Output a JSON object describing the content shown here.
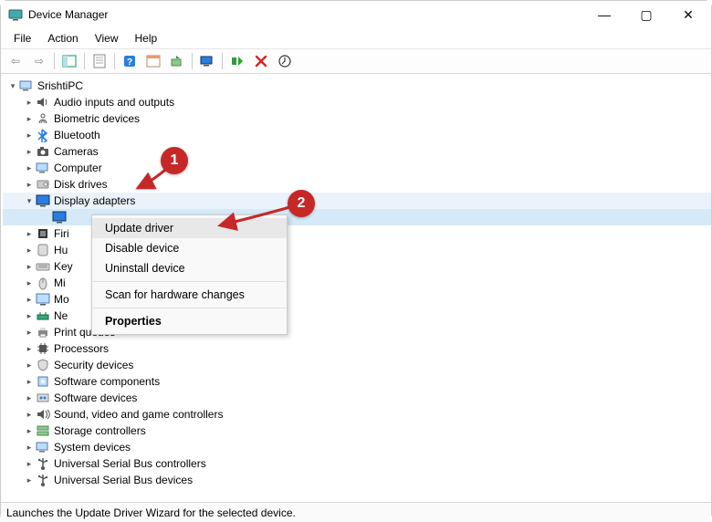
{
  "window": {
    "title": "Device Manager",
    "minimize_glyph": "—",
    "maximize_glyph": "▢",
    "close_glyph": "✕"
  },
  "menubar": {
    "items": [
      "File",
      "Action",
      "View",
      "Help"
    ]
  },
  "toolbar": {
    "back_glyph": "⇦",
    "forward_glyph": "⇨",
    "show_hide_glyph": "⧉",
    "properties_glyph": "📄",
    "help_glyph": "?",
    "calendar_glyph": "📅",
    "update_glyph": "⟳",
    "scan_glyph": "🖥",
    "enable_glyph": "▶",
    "remove_glyph": "✖",
    "install_glyph": "⬇"
  },
  "tree": {
    "root": {
      "label": "SrishtiPC"
    },
    "children": [
      {
        "label": "Audio inputs and outputs",
        "expanded": false
      },
      {
        "label": "Biometric devices",
        "expanded": false
      },
      {
        "label": "Bluetooth",
        "expanded": false
      },
      {
        "label": "Cameras",
        "expanded": false
      },
      {
        "label": "Computer",
        "expanded": false
      },
      {
        "label": "Disk drives",
        "expanded": false
      },
      {
        "label": "Display adapters",
        "expanded": true,
        "child_label": ""
      },
      {
        "label": "Firi",
        "expanded": false
      },
      {
        "label": "Hu",
        "expanded": false
      },
      {
        "label": "Key",
        "expanded": false
      },
      {
        "label": "Mi",
        "expanded": false
      },
      {
        "label": "Mo",
        "expanded": false
      },
      {
        "label": "Ne",
        "expanded": false
      },
      {
        "label": "Print queues",
        "expanded": false
      },
      {
        "label": "Processors",
        "expanded": false
      },
      {
        "label": "Security devices",
        "expanded": false
      },
      {
        "label": "Software components",
        "expanded": false
      },
      {
        "label": "Software devices",
        "expanded": false
      },
      {
        "label": "Sound, video and game controllers",
        "expanded": false
      },
      {
        "label": "Storage controllers",
        "expanded": false
      },
      {
        "label": "System devices",
        "expanded": false
      },
      {
        "label": "Universal Serial Bus controllers",
        "expanded": false
      },
      {
        "label": "Universal Serial Bus devices",
        "expanded": false
      }
    ]
  },
  "context_menu": {
    "items": {
      "update": "Update driver",
      "disable": "Disable device",
      "uninstall": "Uninstall device",
      "scan": "Scan for hardware changes",
      "properties": "Properties"
    }
  },
  "statusbar": {
    "text": "Launches the Update Driver Wizard for the selected device."
  },
  "annotations": {
    "badge1": "1",
    "badge2": "2"
  }
}
